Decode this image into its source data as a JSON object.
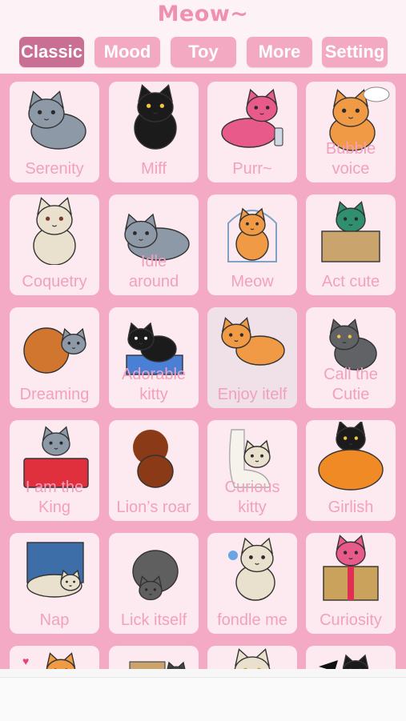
{
  "app": {
    "title": "Meow~"
  },
  "tabs": [
    {
      "label": "Classic",
      "active": true
    },
    {
      "label": "Mood",
      "active": false
    },
    {
      "label": "Toy",
      "active": false
    },
    {
      "label": "More",
      "active": false
    },
    {
      "label": "Setting",
      "active": false
    }
  ],
  "items": [
    {
      "label": "Serenity",
      "icon": "gray-cat-calm-icon"
    },
    {
      "label": "Miff",
      "icon": "black-cat-angry-icon"
    },
    {
      "label": "Purr~",
      "icon": "pink-cat-lying-icon"
    },
    {
      "label": "Bubble\nvoice",
      "icon": "orange-cat-thought-bubble-icon"
    },
    {
      "label": "Coquetry",
      "icon": "beige-cat-sitting-icon"
    },
    {
      "label": "Idle\naround",
      "icon": "gray-cat-lying-icon"
    },
    {
      "label": "Meow",
      "icon": "orange-cat-in-cage-icon"
    },
    {
      "label": "Act cute",
      "icon": "cat-in-box-icon"
    },
    {
      "label": "Dreaming",
      "icon": "cats-with-yarn-ball-icon"
    },
    {
      "label": "Adorable\nkitty",
      "icon": "black-cat-in-litter-box-icon"
    },
    {
      "label": "Enjoy itelf",
      "icon": "orange-cat-stretching-icon"
    },
    {
      "label": "Call the\nCutie",
      "icon": "gray-cat-waving-icon"
    },
    {
      "label": "I am the\nKing",
      "icon": "cat-in-basket-icon"
    },
    {
      "label": "Lion’s roar",
      "icon": "lion-shadow-icon"
    },
    {
      "label": "Curious\nkitty",
      "icon": "cat-in-toilet-icon"
    },
    {
      "label": "Girlish",
      "icon": "black-cat-in-pumpkin-icon"
    },
    {
      "label": "Nap",
      "icon": "cat-on-laptop-icon"
    },
    {
      "label": "Lick itself",
      "icon": "black-cat-licking-icon"
    },
    {
      "label": "fondle me",
      "icon": "cream-cat-with-flower-icon"
    },
    {
      "label": "Curiosity",
      "icon": "pink-cat-in-gift-box-icon"
    },
    {
      "label": "",
      "icon": "orange-cat-with-hearts-icon"
    },
    {
      "label": "",
      "icon": "cat-with-box-icon"
    },
    {
      "label": "",
      "icon": "cream-cat-peeking-icon"
    },
    {
      "label": "",
      "icon": "black-cat-with-bat-icon"
    }
  ],
  "colors": {
    "accent": "#f08fb1",
    "tab_bg": "#f4a9c3",
    "tab_active": "#c96f94",
    "grid_bg": "#f4a9c4",
    "card_bg": "#fdeaf1",
    "label": "#f2a0bd",
    "orange_cat": "#f19a45",
    "gray_cat": "#8d99a6",
    "black_cat": "#1b1b1b",
    "pink_cat": "#e85a8a",
    "cream_cat": "#e9e0cd"
  }
}
